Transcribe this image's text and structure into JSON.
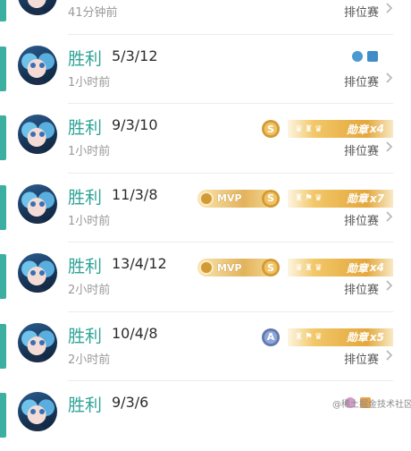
{
  "colors": {
    "win": "#2fa497",
    "accent_bar": "#3dafa0",
    "gold": "#e3a83d",
    "grade_a": "#6178b0"
  },
  "rows": [
    {
      "time": "41分钟前",
      "mode": "排位赛"
    },
    {
      "result": "胜利",
      "kda": "5/3/12",
      "time": "1小时前",
      "mode": "排位赛",
      "icons": [
        "blue-emblem-icon",
        "blue-trophy-icon"
      ]
    },
    {
      "result": "胜利",
      "kda": "9/3/10",
      "time": "1小时前",
      "mode": "排位赛",
      "grade": "S",
      "medal": {
        "label": "勋章",
        "count": "x4"
      }
    },
    {
      "result": "胜利",
      "kda": "11/3/8",
      "time": "1小时前",
      "mode": "排位赛",
      "mvp": "MVP",
      "grade": "S",
      "medal": {
        "label": "勋章",
        "count": "x7"
      }
    },
    {
      "result": "胜利",
      "kda": "13/4/12",
      "time": "2小时前",
      "mode": "排位赛",
      "mvp": "MVP",
      "grade": "S",
      "medal": {
        "label": "勋章",
        "count": "x4"
      }
    },
    {
      "result": "胜利",
      "kda": "10/4/8",
      "time": "2小时前",
      "mode": "排位赛",
      "grade": "A",
      "medal": {
        "label": "勋章",
        "count": "x5"
      }
    },
    {
      "result": "胜利",
      "kda": "9/3/6",
      "icons": [
        "pink-emblem-icon",
        "orange-trophy-icon"
      ]
    }
  ],
  "watermark": "@稀土掘金技术社区"
}
